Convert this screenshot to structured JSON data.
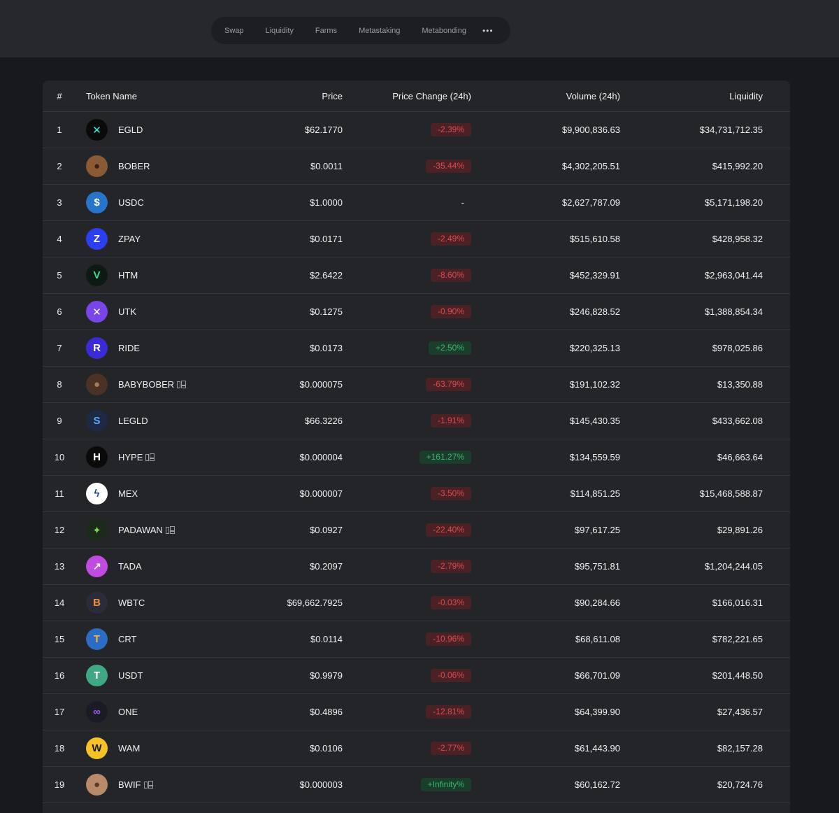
{
  "nav": {
    "items": [
      "Swap",
      "Liquidity",
      "Farms",
      "Metastaking",
      "Metabonding"
    ],
    "more": "•••"
  },
  "table": {
    "headers": {
      "index": "#",
      "name": "Token Name",
      "price": "Price",
      "change": "Price Change (24h)",
      "volume": "Volume (24h)",
      "liquidity": "Liquidity"
    },
    "rows": [
      {
        "index": "1",
        "name": "EGLD",
        "icon": "egld-icon",
        "icon_bg": "#0a0a0a",
        "icon_fg": "#23f7dd",
        "glyph": "✕",
        "verified": false,
        "price": "$62.1770",
        "change": "-2.39%",
        "trend": "neg",
        "volume": "$9,900,836.63",
        "liquidity": "$34,731,712.35"
      },
      {
        "index": "2",
        "name": "BOBER",
        "icon": "bober-icon",
        "icon_bg": "#8a5a35",
        "icon_fg": "#3a2413",
        "glyph": "●",
        "verified": false,
        "price": "$0.0011",
        "change": "-35.44%",
        "trend": "neg",
        "volume": "$4,302,205.51",
        "liquidity": "$415,992.20"
      },
      {
        "index": "3",
        "name": "USDC",
        "icon": "usdc-icon",
        "icon_bg": "#2775ca",
        "icon_fg": "#ffffff",
        "glyph": "$",
        "verified": false,
        "price": "$1.0000",
        "change": "-",
        "trend": "none",
        "volume": "$2,627,787.09",
        "liquidity": "$5,171,198.20"
      },
      {
        "index": "4",
        "name": "ZPAY",
        "icon": "zpay-icon",
        "icon_bg": "#2b3ef0",
        "icon_fg": "#ffffff",
        "glyph": "Z",
        "verified": false,
        "price": "$0.0171",
        "change": "-2.49%",
        "trend": "neg",
        "volume": "$515,610.58",
        "liquidity": "$428,958.32"
      },
      {
        "index": "5",
        "name": "HTM",
        "icon": "htm-icon",
        "icon_bg": "#0d1a14",
        "icon_fg": "#39e08a",
        "glyph": "V",
        "verified": false,
        "price": "$2.6422",
        "change": "-8.60%",
        "trend": "neg",
        "volume": "$452,329.91",
        "liquidity": "$2,963,041.44"
      },
      {
        "index": "6",
        "name": "UTK",
        "icon": "utk-icon",
        "icon_bg": "#7a45e8",
        "icon_fg": "#ffffff",
        "glyph": "✕",
        "verified": false,
        "price": "$0.1275",
        "change": "-0.90%",
        "trend": "neg",
        "volume": "$246,828.52",
        "liquidity": "$1,388,854.34"
      },
      {
        "index": "7",
        "name": "RIDE",
        "icon": "ride-icon",
        "icon_bg": "#3b2bd6",
        "icon_fg": "#ffffff",
        "glyph": "R",
        "verified": false,
        "price": "$0.0173",
        "change": "+2.50%",
        "trend": "pos",
        "volume": "$220,325.13",
        "liquidity": "$978,025.86"
      },
      {
        "index": "8",
        "name": "BABYBOBER",
        "icon": "babybober-icon",
        "icon_bg": "#4a3325",
        "icon_fg": "#a57a55",
        "glyph": "●",
        "verified": true,
        "price": "$0.000075",
        "change": "-63.79%",
        "trend": "neg",
        "volume": "$191,102.32",
        "liquidity": "$13,350.88"
      },
      {
        "index": "9",
        "name": "LEGLD",
        "icon": "legld-icon",
        "icon_bg": "#1e2a44",
        "icon_fg": "#5aa9ff",
        "glyph": "S",
        "verified": false,
        "price": "$66.3226",
        "change": "-1.91%",
        "trend": "neg",
        "volume": "$145,430.35",
        "liquidity": "$433,662.08"
      },
      {
        "index": "10",
        "name": "HYPE",
        "icon": "hype-icon",
        "icon_bg": "#0a0a0a",
        "icon_fg": "#ffffff",
        "glyph": "H",
        "verified": true,
        "price": "$0.000004",
        "change": "+161.27%",
        "trend": "pos",
        "volume": "$134,559.59",
        "liquidity": "$46,663.64"
      },
      {
        "index": "11",
        "name": "MEX",
        "icon": "mex-icon",
        "icon_bg": "#ffffff",
        "icon_fg": "#1d3d9a",
        "glyph": "ϟ",
        "verified": false,
        "price": "$0.000007",
        "change": "-3.50%",
        "trend": "neg",
        "volume": "$114,851.25",
        "liquidity": "$15,468,588.87"
      },
      {
        "index": "12",
        "name": "PADAWAN",
        "icon": "padawan-icon",
        "icon_bg": "#1c2a1c",
        "icon_fg": "#7ccf4a",
        "glyph": "✦",
        "verified": true,
        "price": "$0.0927",
        "change": "-22.40%",
        "trend": "neg",
        "volume": "$97,617.25",
        "liquidity": "$29,891.26"
      },
      {
        "index": "13",
        "name": "TADA",
        "icon": "tada-icon",
        "icon_bg": "#c04be0",
        "icon_fg": "#ffffff",
        "glyph": "↗",
        "verified": false,
        "price": "$0.2097",
        "change": "-2.79%",
        "trend": "neg",
        "volume": "$95,751.81",
        "liquidity": "$1,204,244.05"
      },
      {
        "index": "14",
        "name": "WBTC",
        "icon": "wbtc-icon",
        "icon_bg": "#2a2c3a",
        "icon_fg": "#f0913a",
        "glyph": "B",
        "verified": false,
        "price": "$69,662.7925",
        "change": "-0.03%",
        "trend": "neg",
        "volume": "$90,284.66",
        "liquidity": "$166,016.31"
      },
      {
        "index": "15",
        "name": "CRT",
        "icon": "crt-icon",
        "icon_bg": "#2b6cc4",
        "icon_fg": "#f3b443",
        "glyph": "T",
        "verified": false,
        "price": "$0.0114",
        "change": "-10.96%",
        "trend": "neg",
        "volume": "$68,611.08",
        "liquidity": "$782,221.65"
      },
      {
        "index": "16",
        "name": "USDT",
        "icon": "usdt-icon",
        "icon_bg": "#3fa784",
        "icon_fg": "#ffffff",
        "glyph": "T",
        "verified": false,
        "price": "$0.9979",
        "change": "-0.06%",
        "trend": "neg",
        "volume": "$66,701.09",
        "liquidity": "$201,448.50"
      },
      {
        "index": "17",
        "name": "ONE",
        "icon": "one-icon",
        "icon_bg": "#1a1b26",
        "icon_fg": "#a35ff0",
        "glyph": "∞",
        "verified": false,
        "price": "$0.4896",
        "change": "-12.81%",
        "trend": "neg",
        "volume": "$64,399.90",
        "liquidity": "$27,436.57"
      },
      {
        "index": "18",
        "name": "WAM",
        "icon": "wam-icon",
        "icon_bg": "#f5c227",
        "icon_fg": "#1a1a1a",
        "glyph": "W",
        "verified": false,
        "price": "$0.0106",
        "change": "-2.77%",
        "trend": "neg",
        "volume": "$61,443.90",
        "liquidity": "$82,157.28"
      },
      {
        "index": "19",
        "name": "BWIF",
        "icon": "bwif-icon",
        "icon_bg": "#b88a6a",
        "icon_fg": "#5a3b28",
        "glyph": "●",
        "verified": true,
        "price": "$0.000003",
        "change": "+Infinity%",
        "trend": "pos",
        "volume": "$60,162.72",
        "liquidity": "$20,724.76"
      }
    ]
  }
}
